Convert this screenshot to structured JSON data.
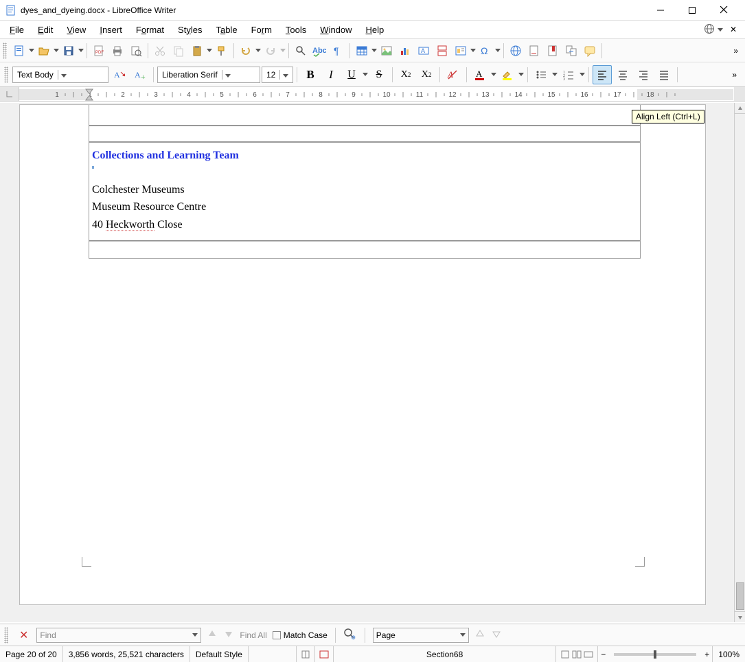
{
  "window": {
    "title": "dyes_and_dyeing.docx - LibreOffice Writer"
  },
  "menubar": [
    "File",
    "Edit",
    "View",
    "Insert",
    "Format",
    "Styles",
    "Table",
    "Form",
    "Tools",
    "Window",
    "Help"
  ],
  "formatting": {
    "paragraph_style": "Text Body",
    "font_name": "Liberation Serif",
    "font_size": "12"
  },
  "tooltip": "Align Left (Ctrl+L)",
  "document": {
    "heading": "Collections and Learning Team",
    "lines": [
      "Colchester Museums",
      "Museum Resource Centre",
      "40 Heckworth Close"
    ]
  },
  "findbar": {
    "placeholder": "Find",
    "find_all": "Find All",
    "match_case": "Match Case",
    "navigate_placeholder": "Page"
  },
  "statusbar": {
    "page": "Page 20 of 20",
    "words": "3,856 words, 25,521 characters",
    "style": "Default Style",
    "section": "Section68",
    "zoom": "100%"
  },
  "ruler": {
    "marks": [
      1,
      1,
      2,
      3,
      4,
      5,
      6,
      7,
      8,
      9,
      10,
      11,
      12,
      13,
      14,
      15,
      16,
      17,
      18
    ]
  }
}
